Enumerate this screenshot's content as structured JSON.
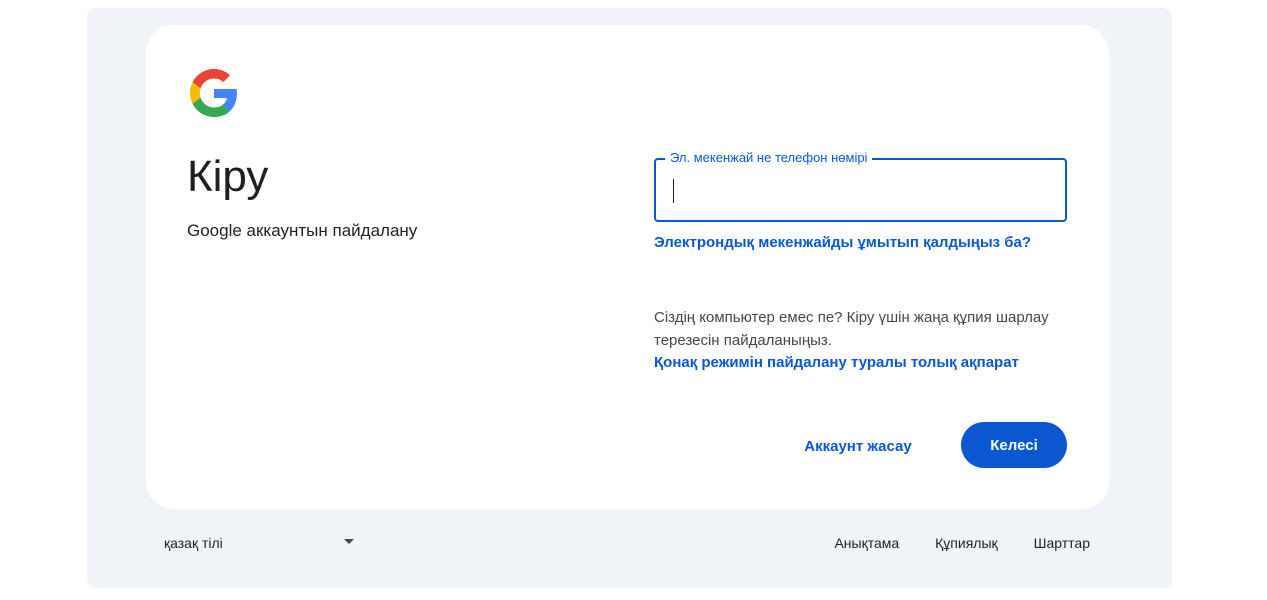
{
  "brand": {
    "logo": "google-g-logo",
    "colors": {
      "blue": "#4285F4",
      "red": "#EA4335",
      "yellow": "#FBBC05",
      "green": "#34A853",
      "accent": "#0b57d0"
    }
  },
  "signin": {
    "title": "Кіру",
    "subtitle": "Google аккаунтын пайдалану",
    "email_label": "Эл. мекенжай не телефон нөмірі",
    "email_value": "",
    "forgot_email": "Электрондық мекенжайды ұмытып қалдыңыз ба?",
    "guest_text": "Сіздің компьютер емес пе? Кіру үшін жаңа құпия шарлау терезесін пайдаланыңыз.",
    "guest_link": "Қонақ режимін пайдалану туралы толық ақпарат",
    "create_account": "Аккаунт жасау",
    "next": "Келесі"
  },
  "footer": {
    "language": "қазақ тілі",
    "links": [
      "Анықтама",
      "Құпиялық",
      "Шарттар"
    ]
  }
}
